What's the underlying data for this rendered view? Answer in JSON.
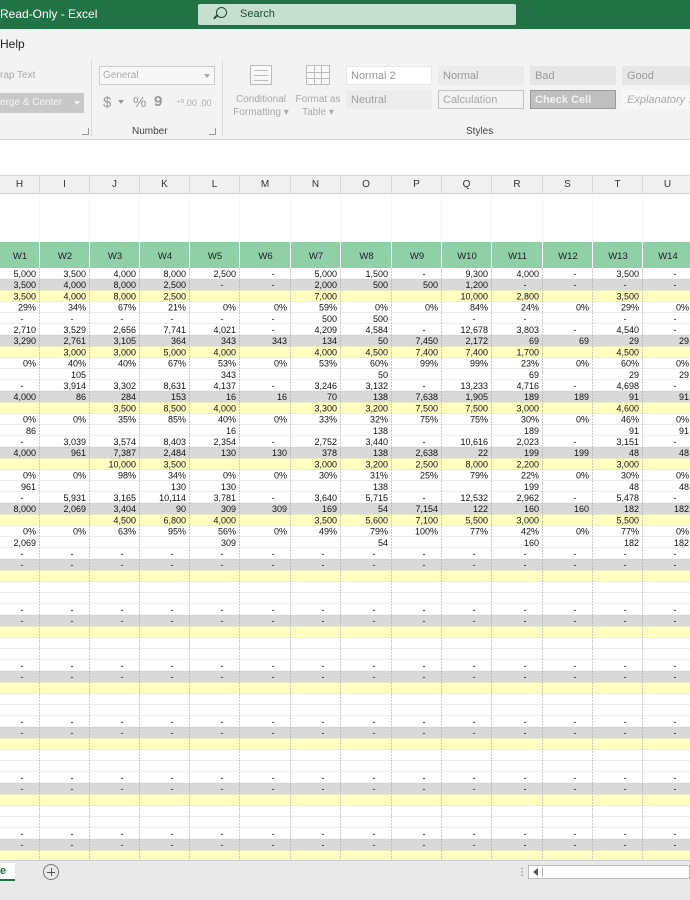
{
  "titlebar": {
    "title": "Read-Only  -  Excel",
    "search_placeholder": "Search"
  },
  "menu": {
    "help": "Help"
  },
  "ribbon": {
    "wrap_text": "rap Text",
    "merge_center": "erge & Center",
    "number_format": "General",
    "currency_symbol": "$",
    "percent_symbol": "%",
    "comma_symbol": "9",
    "increase_decimal": "⁺⁰.00",
    "decrease_decimal": ".00",
    "number_group": "Number",
    "conditional_formatting": [
      "Conditional",
      "Formatting"
    ],
    "format_as_table": [
      "Format as",
      "Table"
    ],
    "styles_group": "Styles",
    "styles": [
      {
        "label": "Normal 2",
        "bg": "#ffffff",
        "color": "#999999",
        "border": "#e8e8e8"
      },
      {
        "label": "Normal",
        "bg": "#ebebeb",
        "color": "#999999",
        "border": "#ebebeb"
      },
      {
        "label": "Bad",
        "bg": "#e6e6e6",
        "color": "#9a9a9a",
        "border": "#e6e6e6"
      },
      {
        "label": "Good",
        "bg": "#e6e6e6",
        "color": "#9a9a9a",
        "border": "#e6e6e6"
      },
      {
        "label": "Neutral",
        "bg": "#ececec",
        "color": "#a0a0a0",
        "border": "#ececec"
      },
      {
        "label": "Calculation",
        "bg": "#f2f2f2",
        "color": "#a8a8a8",
        "border": "#c4c4c4"
      },
      {
        "label": "Check Cell",
        "bg": "#bfbfbf",
        "color": "#f2f2f2",
        "border": "#9a9a9a"
      },
      {
        "label": "Explanatory ...",
        "bg": "#f7f7f7",
        "color": "#aaaaaa",
        "border": "#f7f7f7"
      }
    ]
  },
  "columns": [
    "H",
    "I",
    "J",
    "K",
    "L",
    "M",
    "N",
    "O",
    "P",
    "Q",
    "R",
    "S",
    "T",
    "U"
  ],
  "week_headers": [
    "W1",
    "W2",
    "W3",
    "W4",
    "W5",
    "W6",
    "W7",
    "W8",
    "W9",
    "W10",
    "W11",
    "W12",
    "W13",
    "W14"
  ],
  "rows": [
    {
      "t": "w",
      "c": [
        "5,000",
        "3,500",
        "4,000",
        "8,000",
        "2,500",
        "-",
        "5,000",
        "1,500",
        "-",
        "9,300",
        "4,000",
        "-",
        "3,500",
        "-"
      ]
    },
    {
      "t": "g",
      "c": [
        "3,500",
        "4,000",
        "8,000",
        "2,500",
        "-",
        "-",
        "2,000",
        "500",
        "500",
        "1,200",
        "-",
        "-",
        "-",
        "-"
      ]
    },
    {
      "t": "y",
      "c": [
        "3,500",
        "4,000",
        "8,000",
        "2,500",
        "",
        "",
        "7,000",
        "",
        "",
        "10,000",
        "2,800",
        "",
        "3,500",
        ""
      ]
    },
    {
      "t": "w",
      "c": [
        "29%",
        "34%",
        "67%",
        "21%",
        "0%",
        "0%",
        "59%",
        "0%",
        "0%",
        "84%",
        "24%",
        "0%",
        "29%",
        "0%"
      ]
    },
    {
      "t": "w",
      "c": [
        "-",
        "-",
        "-",
        "-",
        "-",
        "-",
        "500",
        "500",
        "",
        "-",
        "-",
        "",
        "-",
        "-"
      ]
    },
    {
      "t": "w",
      "c": [
        "2,710",
        "3,529",
        "2,656",
        "7,741",
        "4,021",
        "-",
        "4,209",
        "4,584",
        "-",
        "12,678",
        "3,803",
        "-",
        "4,540",
        "-"
      ]
    },
    {
      "t": "g",
      "c": [
        "3,290",
        "2,761",
        "3,105",
        "364",
        "343",
        "343",
        "134",
        "50",
        "7,450",
        "2,172",
        "69",
        "69",
        "29",
        "29"
      ]
    },
    {
      "t": "y",
      "c": [
        "",
        "3,000",
        "3,000",
        "5,000",
        "4,000",
        "",
        "4,000",
        "4,500",
        "7,400",
        "7,400",
        "1,700",
        "",
        "4,500",
        ""
      ]
    },
    {
      "t": "w",
      "c": [
        "0%",
        "40%",
        "40%",
        "67%",
        "53%",
        "0%",
        "53%",
        "60%",
        "99%",
        "99%",
        "23%",
        "0%",
        "60%",
        "0%"
      ]
    },
    {
      "t": "w",
      "c": [
        "",
        "105",
        "",
        "",
        "343",
        "",
        "",
        "50",
        "",
        "",
        "69",
        "",
        "29",
        "29"
      ]
    },
    {
      "t": "w",
      "c": [
        "-",
        "3,914",
        "3,302",
        "8,631",
        "4,137",
        "-",
        "3,246",
        "3,132",
        "-",
        "13,233",
        "4,716",
        "-",
        "4,698",
        "-"
      ]
    },
    {
      "t": "g",
      "c": [
        "4,000",
        "86",
        "284",
        "153",
        "16",
        "16",
        "70",
        "138",
        "7,638",
        "1,905",
        "189",
        "189",
        "91",
        "91"
      ]
    },
    {
      "t": "y",
      "c": [
        "",
        "",
        "3,500",
        "8,500",
        "4,000",
        "",
        "3,300",
        "3,200",
        "7,500",
        "7,500",
        "3,000",
        "",
        "4,600",
        ""
      ]
    },
    {
      "t": "w",
      "c": [
        "0%",
        "0%",
        "35%",
        "85%",
        "40%",
        "0%",
        "33%",
        "32%",
        "75%",
        "75%",
        "30%",
        "0%",
        "46%",
        "0%"
      ]
    },
    {
      "t": "w",
      "c": [
        "86",
        "",
        "",
        "",
        "16",
        "",
        "",
        "138",
        "",
        "",
        "189",
        "",
        "91",
        "91"
      ]
    },
    {
      "t": "w",
      "c": [
        "-",
        "3,039",
        "3,574",
        "8,403",
        "2,354",
        "-",
        "2,752",
        "3,440",
        "-",
        "10,616",
        "2,023",
        "-",
        "3,151",
        "-"
      ]
    },
    {
      "t": "g",
      "c": [
        "4,000",
        "961",
        "7,387",
        "2,484",
        "130",
        "130",
        "378",
        "138",
        "2,638",
        "22",
        "199",
        "199",
        "48",
        "48"
      ]
    },
    {
      "t": "y",
      "c": [
        "",
        "",
        "10,000",
        "3,500",
        "",
        "",
        "3,000",
        "3,200",
        "2,500",
        "8,000",
        "2,200",
        "",
        "3,000",
        ""
      ]
    },
    {
      "t": "w",
      "c": [
        "0%",
        "0%",
        "98%",
        "34%",
        "0%",
        "0%",
        "30%",
        "31%",
        "25%",
        "79%",
        "22%",
        "0%",
        "30%",
        "0%"
      ]
    },
    {
      "t": "w",
      "c": [
        "961",
        "",
        "",
        "130",
        "130",
        "",
        "",
        "138",
        "",
        "",
        "199",
        "",
        "48",
        "48"
      ]
    },
    {
      "t": "w",
      "c": [
        "-",
        "5,931",
        "3,165",
        "10,114",
        "3,781",
        "-",
        "3,640",
        "5,715",
        "-",
        "12,532",
        "2,962",
        "-",
        "5,478",
        "-"
      ]
    },
    {
      "t": "g",
      "c": [
        "8,000",
        "2,069",
        "3,404",
        "90",
        "309",
        "309",
        "169",
        "54",
        "7,154",
        "122",
        "160",
        "160",
        "182",
        "182"
      ]
    },
    {
      "t": "y",
      "c": [
        "",
        "",
        "4,500",
        "6,800",
        "4,000",
        "",
        "3,500",
        "5,600",
        "7,100",
        "5,500",
        "3,000",
        "",
        "5,500",
        ""
      ]
    },
    {
      "t": "w",
      "c": [
        "0%",
        "0%",
        "63%",
        "95%",
        "56%",
        "0%",
        "49%",
        "79%",
        "100%",
        "77%",
        "42%",
        "0%",
        "77%",
        "0%"
      ]
    },
    {
      "t": "w",
      "c": [
        "2,069",
        "",
        "",
        "",
        "309",
        "",
        "",
        "54",
        "",
        "",
        "160",
        "",
        "182",
        "182"
      ]
    },
    {
      "t": "w",
      "c": [
        "-",
        "-",
        "-",
        "-",
        "-",
        "-",
        "-",
        "-",
        "-",
        "-",
        "-",
        "-",
        "-",
        "-"
      ]
    },
    {
      "t": "g",
      "c": [
        "-",
        "-",
        "-",
        "-",
        "-",
        "-",
        "-",
        "-",
        "-",
        "-",
        "-",
        "-",
        "-",
        "-"
      ]
    },
    {
      "t": "y",
      "c": [
        "",
        "",
        "",
        "",
        "",
        "",
        "",
        "",
        "",
        "",
        "",
        "",
        "",
        ""
      ]
    },
    {
      "t": "w",
      "c": [
        "",
        "",
        "",
        "",
        "",
        "",
        "",
        "",
        "",
        "",
        "",
        "",
        "",
        ""
      ]
    },
    {
      "t": "w",
      "c": [
        "",
        "",
        "",
        "",
        "",
        "",
        "",
        "",
        "",
        "",
        "",
        "",
        "",
        ""
      ]
    },
    {
      "t": "w",
      "c": [
        "-",
        "-",
        "-",
        "-",
        "-",
        "-",
        "-",
        "-",
        "-",
        "-",
        "-",
        "-",
        "-",
        "-"
      ]
    },
    {
      "t": "g",
      "c": [
        "-",
        "-",
        "-",
        "-",
        "-",
        "-",
        "-",
        "-",
        "-",
        "-",
        "-",
        "-",
        "-",
        "-"
      ]
    },
    {
      "t": "y",
      "c": [
        "",
        "",
        "",
        "",
        "",
        "",
        "",
        "",
        "",
        "",
        "",
        "",
        "",
        ""
      ]
    },
    {
      "t": "w",
      "c": [
        "",
        "",
        "",
        "",
        "",
        "",
        "",
        "",
        "",
        "",
        "",
        "",
        "",
        ""
      ]
    },
    {
      "t": "w",
      "c": [
        "",
        "",
        "",
        "",
        "",
        "",
        "",
        "",
        "",
        "",
        "",
        "",
        "",
        ""
      ]
    },
    {
      "t": "w",
      "c": [
        "-",
        "-",
        "-",
        "-",
        "-",
        "-",
        "-",
        "-",
        "-",
        "-",
        "-",
        "-",
        "-",
        "-"
      ]
    },
    {
      "t": "g",
      "c": [
        "-",
        "-",
        "-",
        "-",
        "-",
        "-",
        "-",
        "-",
        "-",
        "-",
        "-",
        "-",
        "-",
        "-"
      ]
    },
    {
      "t": "y",
      "c": [
        "",
        "",
        "",
        "",
        "",
        "",
        "",
        "",
        "",
        "",
        "",
        "",
        "",
        ""
      ]
    },
    {
      "t": "w",
      "c": [
        "",
        "",
        "",
        "",
        "",
        "",
        "",
        "",
        "",
        "",
        "",
        "",
        "",
        ""
      ]
    },
    {
      "t": "w",
      "c": [
        "",
        "",
        "",
        "",
        "",
        "",
        "",
        "",
        "",
        "",
        "",
        "",
        "",
        ""
      ]
    },
    {
      "t": "w",
      "c": [
        "-",
        "-",
        "-",
        "-",
        "-",
        "-",
        "-",
        "-",
        "-",
        "-",
        "-",
        "-",
        "-",
        "-"
      ]
    },
    {
      "t": "g",
      "c": [
        "-",
        "-",
        "-",
        "-",
        "-",
        "-",
        "-",
        "-",
        "-",
        "-",
        "-",
        "-",
        "-",
        "-"
      ]
    },
    {
      "t": "y",
      "c": [
        "",
        "",
        "",
        "",
        "",
        "",
        "",
        "",
        "",
        "",
        "",
        "",
        "",
        ""
      ]
    },
    {
      "t": "w",
      "c": [
        "",
        "",
        "",
        "",
        "",
        "",
        "",
        "",
        "",
        "",
        "",
        "",
        "",
        ""
      ]
    },
    {
      "t": "w",
      "c": [
        "",
        "",
        "",
        "",
        "",
        "",
        "",
        "",
        "",
        "",
        "",
        "",
        "",
        ""
      ]
    },
    {
      "t": "w",
      "c": [
        "-",
        "-",
        "-",
        "-",
        "-",
        "-",
        "-",
        "-",
        "-",
        "-",
        "-",
        "-",
        "-",
        "-"
      ]
    },
    {
      "t": "g",
      "c": [
        "-",
        "-",
        "-",
        "-",
        "-",
        "-",
        "-",
        "-",
        "-",
        "-",
        "-",
        "-",
        "-",
        "-"
      ]
    },
    {
      "t": "y",
      "c": [
        "",
        "",
        "",
        "",
        "",
        "",
        "",
        "",
        "",
        "",
        "",
        "",
        "",
        ""
      ]
    },
    {
      "t": "w",
      "c": [
        "",
        "",
        "",
        "",
        "",
        "",
        "",
        "",
        "",
        "",
        "",
        "",
        "",
        ""
      ]
    },
    {
      "t": "w",
      "c": [
        "",
        "",
        "",
        "",
        "",
        "",
        "",
        "",
        "",
        "",
        "",
        "",
        "",
        ""
      ]
    },
    {
      "t": "w",
      "c": [
        "-",
        "-",
        "-",
        "-",
        "-",
        "-",
        "-",
        "-",
        "-",
        "-",
        "-",
        "-",
        "-",
        "-"
      ]
    },
    {
      "t": "g",
      "c": [
        "-",
        "-",
        "-",
        "-",
        "-",
        "-",
        "-",
        "-",
        "-",
        "-",
        "-",
        "-",
        "-",
        "-"
      ]
    },
    {
      "t": "y",
      "c": [
        "",
        "",
        "",
        "",
        "",
        "",
        "",
        "",
        "",
        "",
        "",
        "",
        "",
        ""
      ]
    }
  ],
  "colors": {
    "excel_green": "#217346",
    "header_green": "#8fd0a6",
    "row_gray": "#d9d9d9",
    "row_yellow": "#ffffc0"
  },
  "sheet_tab": "e"
}
